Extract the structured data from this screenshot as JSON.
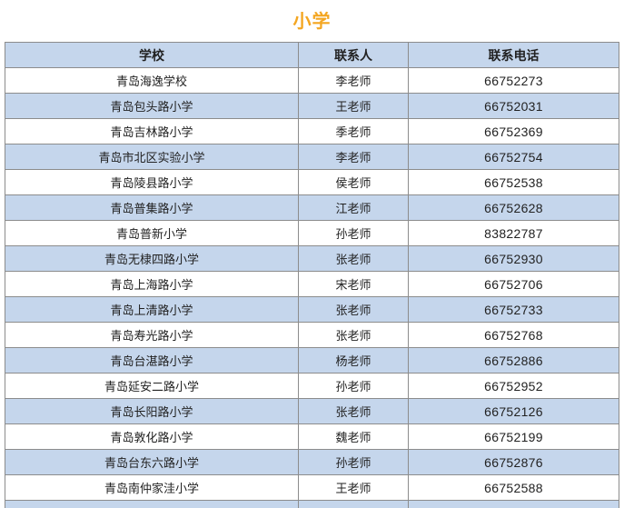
{
  "title": "小学",
  "table": {
    "headers": [
      "学校",
      "联系人",
      "联系电话"
    ],
    "rows": [
      [
        "青岛海逸学校",
        "李老师",
        "66752273"
      ],
      [
        "青岛包头路小学",
        "王老师",
        "66752031"
      ],
      [
        "青岛吉林路小学",
        "季老师",
        "66752369"
      ],
      [
        "青岛市北区实验小学",
        "李老师",
        "66752754"
      ],
      [
        "青岛陵县路小学",
        "侯老师",
        "66752538"
      ],
      [
        "青岛普集路小学",
        "江老师",
        "66752628"
      ],
      [
        "青岛普新小学",
        "孙老师",
        "83822787"
      ],
      [
        "青岛无棣四路小学",
        "张老师",
        "66752930"
      ],
      [
        "青岛上海路小学",
        "宋老师",
        "66752706"
      ],
      [
        "青岛上清路小学",
        "张老师",
        "66752733"
      ],
      [
        "青岛寿光路小学",
        "张老师",
        "66752768"
      ],
      [
        "青岛台湛路小学",
        "杨老师",
        "66752886"
      ],
      [
        "青岛延安二路小学",
        "孙老师",
        "66752952"
      ],
      [
        "青岛长阳路小学",
        "张老师",
        "66752126"
      ],
      [
        "青岛敦化路小学",
        "魏老师",
        "66752199"
      ],
      [
        "青岛台东六路小学",
        "孙老师",
        "66752876"
      ],
      [
        "青岛南仲家洼小学",
        "王老师",
        "66752588"
      ]
    ]
  }
}
